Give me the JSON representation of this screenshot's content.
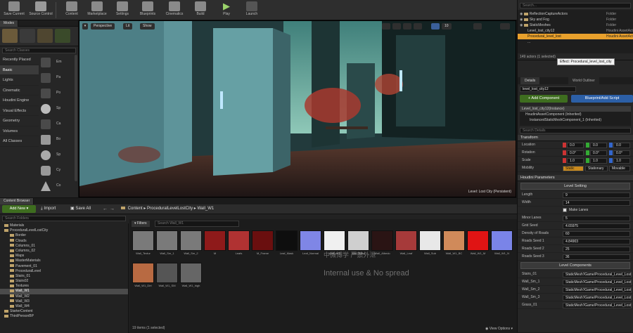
{
  "toolbar": {
    "buttons": [
      {
        "label": "Save Current"
      },
      {
        "label": "Source Control"
      },
      {
        "label": "Content"
      },
      {
        "label": "Marketplace"
      },
      {
        "label": "Settings"
      },
      {
        "label": "Blueprints"
      },
      {
        "label": "Cinematics"
      },
      {
        "label": "Build"
      },
      {
        "label": "Play"
      },
      {
        "label": "Launch"
      }
    ]
  },
  "modes": {
    "tab_label": "Modes",
    "search_placeholder": "Search Classes",
    "categories": [
      "Recently Placed",
      "Basic",
      "Lights",
      "Cinematic",
      "Houdini Engine",
      "Visual Effects",
      "Geometry",
      "Volumes",
      "All Classes"
    ],
    "selected_category": "Basic",
    "place_items": [
      "Em",
      "Pa",
      "Po",
      "Sp",
      "Ca",
      "Bo",
      "Sp",
      "Cy",
      "Co"
    ]
  },
  "viewport": {
    "perspective_label": "Perspective",
    "lit_label": "Lit",
    "show_label": "Show",
    "grid_value": "10",
    "status_text": "Level: Lost City (Persistent)"
  },
  "outliner": {
    "search_placeholder": "Search...",
    "rows": [
      {
        "name": "ReflectionCaptureActors",
        "type": "Folder"
      },
      {
        "name": "Sky and Fog",
        "type": "Folder"
      },
      {
        "name": "StaticMeshes",
        "type": "Folder"
      },
      {
        "name": "Level_lost_city12",
        "type": "Houdini AssetActor"
      },
      {
        "name": "Procedural_level_lost",
        "type": "Houdini AssetActor"
      },
      {
        "name": "...",
        "type": ""
      }
    ],
    "actor_count": "149 actors (1 selected)",
    "tooltip": "Effect: Procedural_level_lost_city"
  },
  "details": {
    "tab_details": "Details",
    "tab_world": "World Outliner",
    "name_field": "level_lost_city12",
    "add_component": "+ Add Component",
    "blueprint_button": "Blueprint/Add Script",
    "instance_label": "Level_lost_city12(Instance)",
    "component1": "HoudiniAssetComponent (Inherited)",
    "component2": "InstancedStaticMeshComponent_1 (Inherited)",
    "search_placeholder": "Search Details",
    "transform_header": "Transform",
    "location_label": "Location",
    "rotation_label": "Rotation",
    "scale_label": "Scale",
    "mobility_label": "Mobility",
    "location": [
      "0.0",
      "0.0",
      "0.0"
    ],
    "rotation": [
      "0.0°",
      "0.0°",
      "0.0°"
    ],
    "scale": [
      "1.0",
      "1.0",
      "1.0"
    ],
    "mobility_options": [
      "Static",
      "Stationary",
      "Movable"
    ],
    "houdini_header": "Houdini Parameters",
    "level_setting": "Level Setting",
    "params": [
      {
        "name": "Length",
        "value": "9"
      },
      {
        "name": "Width",
        "value": "14"
      },
      {
        "name": "",
        "value": "Make Lanes"
      },
      {
        "name": "Minor Lanes",
        "value": "5"
      },
      {
        "name": "Grid Seed",
        "value": "4.65975"
      },
      {
        "name": "Density of Roads",
        "value": "60"
      },
      {
        "name": "Roads Seed 1",
        "value": "4.84903"
      },
      {
        "name": "Roads Seed 2",
        "value": "25"
      },
      {
        "name": "Roads Seed 3",
        "value": "36"
      }
    ],
    "level_components": "Level Components",
    "components": [
      {
        "name": "Stairs_01",
        "value": "StaticMesh'/Game/Procedural_Level_Lost"
      },
      {
        "name": "Wall_Sm_1",
        "value": "StaticMesh'/Game/Procedural_Level_Lost"
      },
      {
        "name": "Wall_Sm_2",
        "value": "StaticMesh'/Game/Procedural_Level_Lost"
      },
      {
        "name": "Wall_Sm_3",
        "value": "StaticMesh'/Game/Procedural_Level_Lost"
      },
      {
        "name": "Grass_01",
        "value": "StaticMesh'/Game/Procedural_Level_Lost"
      }
    ]
  },
  "content_browser": {
    "tab_label": "Content Browser",
    "add_new": "Add New",
    "import": "Import",
    "save_all": "Save All",
    "breadcrumb": [
      "Content",
      "ProceduralLevelLostCity",
      "Wall_W1"
    ],
    "search_folders": "Search Folders",
    "filters": "Filters",
    "search_assets": "Search Wall_W1",
    "tree": [
      {
        "label": "Materials",
        "indent": 1
      },
      {
        "label": "ProceduralLevelLostCity",
        "indent": 1
      },
      {
        "label": "Border",
        "indent": 2
      },
      {
        "label": "Clouds",
        "indent": 2
      },
      {
        "label": "Columns_01",
        "indent": 2
      },
      {
        "label": "Columns_02",
        "indent": 2
      },
      {
        "label": "Maps",
        "indent": 2
      },
      {
        "label": "MasterMaterials",
        "indent": 2
      },
      {
        "label": "Pavement_01",
        "indent": 2
      },
      {
        "label": "ProceduralLevel",
        "indent": 2
      },
      {
        "label": "Stairs_01",
        "indent": 2
      },
      {
        "label": "Stairs02",
        "indent": 2
      },
      {
        "label": "Textures",
        "indent": 2
      },
      {
        "label": "Wall_W1",
        "indent": 2,
        "selected": true
      },
      {
        "label": "Wall_W2",
        "indent": 2
      },
      {
        "label": "Wall_W3",
        "indent": 2
      },
      {
        "label": "Wall_W4",
        "indent": 2
      },
      {
        "label": "StarterContent",
        "indent": 1
      },
      {
        "label": "ThirdPersonBP",
        "indent": 1
      }
    ],
    "assets_row1": [
      {
        "label": "Wall_Textur",
        "color": "#7a7a7a"
      },
      {
        "label": "Wall_Sm_1",
        "color": "#7a7a7a"
      },
      {
        "label": "Wall_Sm_2",
        "color": "#7a7a7a"
      },
      {
        "label": "M",
        "color": "#8e1a1a"
      },
      {
        "label": "Leafs",
        "color": "#b03232"
      },
      {
        "label": "M_Frame",
        "color": "#6a0f0f"
      },
      {
        "label": "Leaf_Mask",
        "color": "#0e0e0e"
      },
      {
        "label": "Leaf_Normal",
        "color": "#7f86e6"
      },
      {
        "label": "Wall_AO",
        "color": "#f0f0f0"
      },
      {
        "label": "Wall_Base",
        "color": "#cfcfcf"
      },
      {
        "label": "Wall_Albedo",
        "color": "#2a1414"
      },
      {
        "label": "Wall_Leaf",
        "color": "#a63a3a"
      },
      {
        "label": "Wall_Sub",
        "color": "#e8e8e8"
      },
      {
        "label": "Wall_W1_BC",
        "color": "#d08a5a"
      },
      {
        "label": "Wall_W1_M",
        "color": "#e01414"
      },
      {
        "label": "Wall_W1_N",
        "color": "#7a84e8"
      }
    ],
    "assets_row2": [
      {
        "label": "Wall_W1_Dirt",
        "color": "#b86a42"
      },
      {
        "label": "Wall_W1_SM",
        "color": "#555555"
      },
      {
        "label": "Wall_W1_high",
        "color": "#666666"
      }
    ],
    "item_count": "19 items (1 selected)",
    "view_options": "View Options"
  },
  "watermark": {
    "line1": "中微博学 严禁外泄",
    "line2": "Internal use & No spread"
  }
}
